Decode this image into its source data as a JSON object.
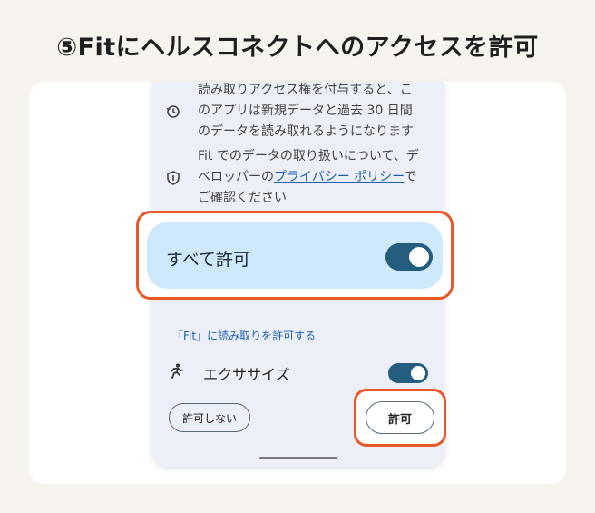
{
  "title": "⑤Fitにヘルスコネクトへのアクセスを許可",
  "info": {
    "history_line1": "読み取りアクセス権を付与すると、こ",
    "history_line2": "のアプリは新規データと過去 30 日間",
    "history_line3": "のデータを読み取れるようになります",
    "privacy_line1": "Fit でのデータの取り扱いについて、デ",
    "privacy_prefix": "ベロッパーの",
    "privacy_link": "プライバシー ポリシー",
    "privacy_suffix": "で",
    "privacy_line3": "ご確認ください"
  },
  "all_allow": {
    "label": "すべて許可",
    "on": true
  },
  "section_label": "「Fit」に読み取りを許可する",
  "exercise": {
    "label": "エクササイズ",
    "on": true
  },
  "buttons": {
    "deny": "許可しない",
    "allow": "許可"
  },
  "icons": [
    "history-icon",
    "shield-icon",
    "running-icon"
  ],
  "colors": {
    "highlight": "#e8582a",
    "toggle": "#245d7d",
    "selected_bg": "#cfe9fc",
    "link": "#1a5fb4"
  }
}
